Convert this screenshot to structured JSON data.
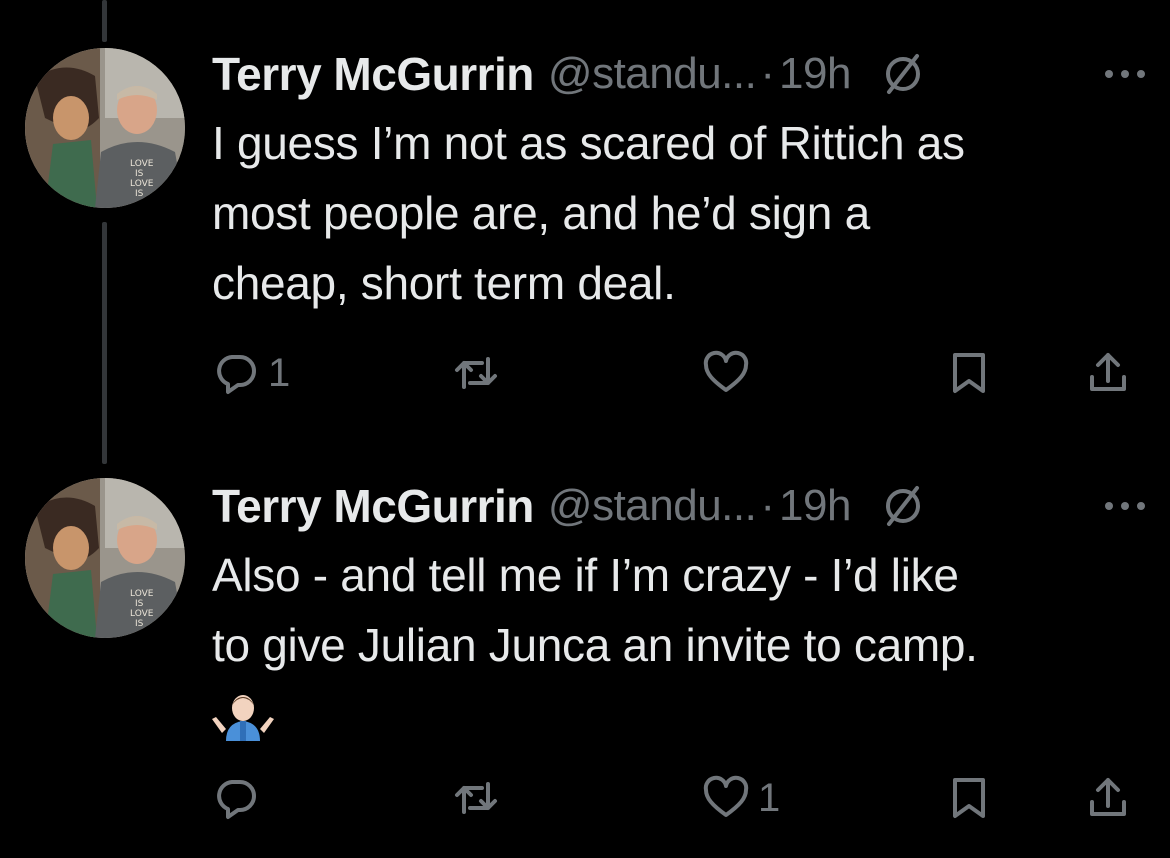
{
  "tweets": [
    {
      "name": "Terry McGurrin",
      "handle": "@standu...",
      "separator": "·",
      "time": "19h",
      "text_lines": [
        "I guess I’m not as scared of Rittich as",
        "most people are, and he’d sign a",
        "cheap, short term deal."
      ],
      "emoji": "",
      "reply_count": "1",
      "like_count": "",
      "avatar_shirt_text": [
        "LOVE",
        "IS",
        "LOVE",
        "IS"
      ]
    },
    {
      "name": "Terry McGurrin",
      "handle": "@standu...",
      "separator": "·",
      "time": "19h",
      "text_lines": [
        "Also - and tell me if I’m crazy - I’d like",
        "to give Julian Junca an invite to camp."
      ],
      "emoji": "🤷🏻‍♂️",
      "reply_count": "",
      "like_count": "1",
      "avatar_shirt_text": [
        "LOVE",
        "IS",
        "LOVE",
        "IS"
      ]
    }
  ],
  "icons": {
    "audience": "circle-slash-icon",
    "more": "more-horizontal-icon",
    "reply": "reply-icon",
    "repost": "repost-icon",
    "like": "heart-icon",
    "bookmark": "bookmark-icon",
    "share": "share-icon"
  },
  "colors": {
    "background": "#000000",
    "primary_text": "#e7e9ea",
    "secondary_text": "#71767b",
    "thread_line": "#333639"
  }
}
